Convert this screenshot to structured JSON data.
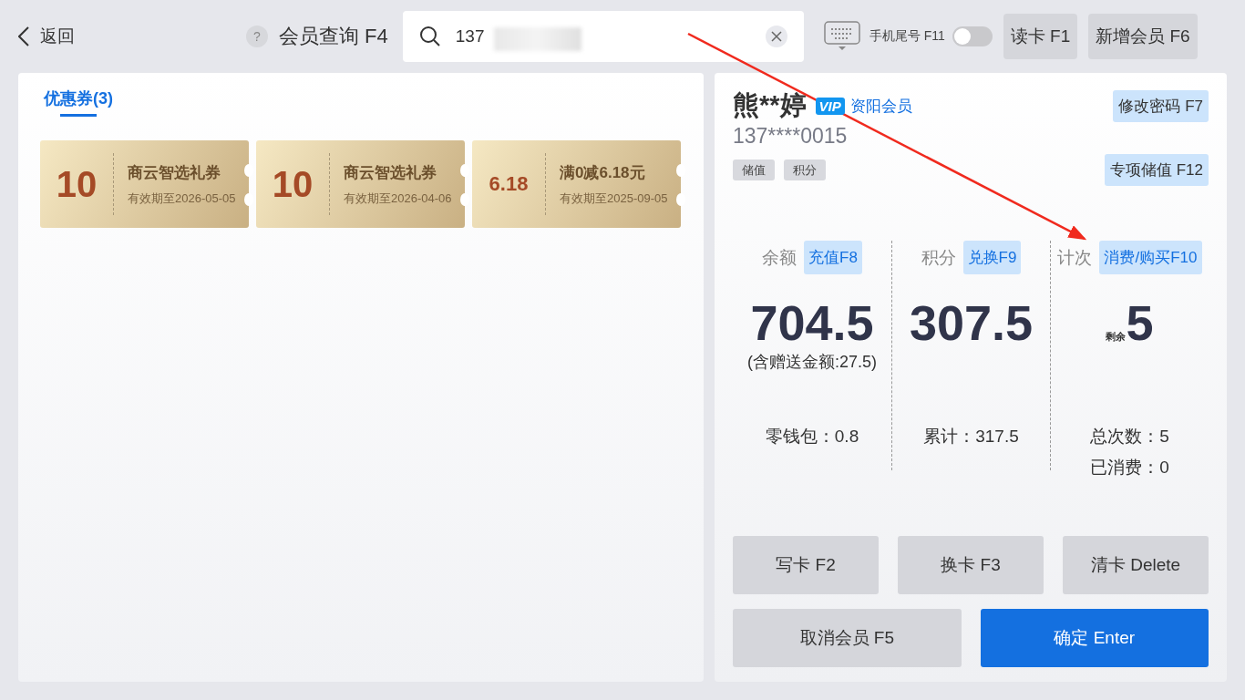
{
  "header": {
    "back": "返回",
    "help": "?",
    "title": "会员查询 F4",
    "search": {
      "value": "137"
    },
    "toggle": {
      "label": "手机尾号 F11",
      "on": false
    },
    "buttons": [
      "读卡 F1",
      "新增会员 F6"
    ]
  },
  "coupon_panel": {
    "tabs": [
      {
        "label": "优惠券(3)",
        "selected": true
      }
    ],
    "coupons": [
      {
        "amount": "10",
        "name": "商云智选礼券",
        "expiry": "有效期至2026-05-05"
      },
      {
        "amount": "10",
        "name": "商云智选礼券",
        "expiry": "有效期至2026-04-06"
      },
      {
        "amount": "6.18",
        "name": "满0减6.18元",
        "expiry": "有效期至2025-09-05"
      }
    ]
  },
  "member": {
    "name": "熊**婷",
    "badge": "VIP",
    "group": "资阳会员",
    "phone": "137****0015",
    "tags": [
      "储值",
      "积分"
    ],
    "actions": [
      "修改密码 F7",
      "专项储值 F12"
    ]
  },
  "stats": [
    {
      "label": "余额",
      "action": "充值F8",
      "value": "704.5",
      "note": "(含赠送金额:27.5)",
      "details": [
        "零钱包：0.8"
      ]
    },
    {
      "label": "积分",
      "action": "兑换F9",
      "value": "307.5",
      "details": [
        "累计：317.5"
      ]
    },
    {
      "label": "计次",
      "action": "消费/购买F10",
      "prefix": "剩余",
      "value": "5",
      "details": [
        "总次数：5",
        "已消费：0"
      ]
    }
  ],
  "buttons": [
    {
      "label": "写卡 F2",
      "kind": "secondary"
    },
    {
      "label": "换卡 F3",
      "kind": "secondary"
    },
    {
      "label": "清卡 Delete",
      "kind": "secondary"
    },
    {
      "label": "取消会员 F5",
      "kind": "secondary"
    },
    {
      "label": "确定 Enter",
      "kind": "primary"
    }
  ]
}
